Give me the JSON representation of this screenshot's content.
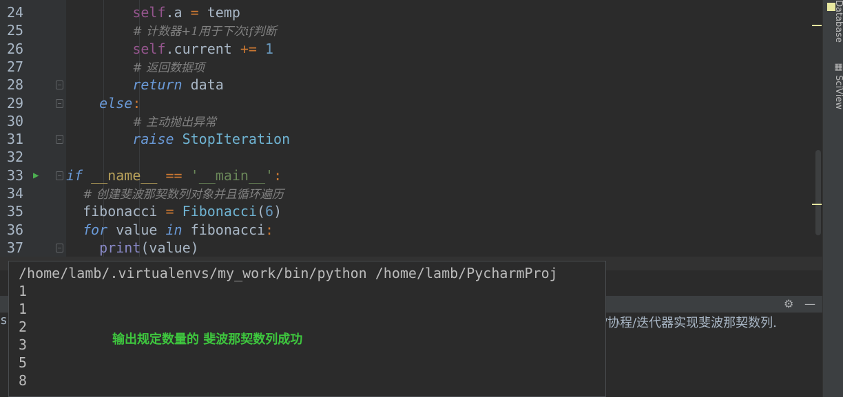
{
  "editor": {
    "lines": [
      {
        "num": "24",
        "indent": "        ",
        "tokens": [
          {
            "t": "self",
            "c": "kw-self"
          },
          {
            "t": ".a ",
            "c": "plain"
          },
          {
            "t": "=",
            "c": "op"
          },
          {
            "t": " temp",
            "c": "plain"
          }
        ]
      },
      {
        "num": "25",
        "indent": "        ",
        "tokens": [
          {
            "t": "# 计数器+1用于下次if判断",
            "c": "cmt"
          }
        ]
      },
      {
        "num": "26",
        "indent": "        ",
        "tokens": [
          {
            "t": "self",
            "c": "kw-self"
          },
          {
            "t": ".current ",
            "c": "plain"
          },
          {
            "t": "+=",
            "c": "op"
          },
          {
            "t": " ",
            "c": "plain"
          },
          {
            "t": "1",
            "c": "num"
          }
        ]
      },
      {
        "num": "27",
        "indent": "        ",
        "tokens": [
          {
            "t": "# 返回数据项",
            "c": "cmt"
          }
        ]
      },
      {
        "num": "28",
        "indent": "        ",
        "tokens": [
          {
            "t": "return",
            "c": "kw-i"
          },
          {
            "t": " data",
            "c": "plain"
          }
        ]
      },
      {
        "num": "29",
        "indent": "    ",
        "tokens": [
          {
            "t": "else",
            "c": "kw-i"
          },
          {
            "t": ":",
            "c": "op"
          }
        ]
      },
      {
        "num": "30",
        "indent": "        ",
        "tokens": [
          {
            "t": "# 主动抛出异常",
            "c": "cmt"
          }
        ]
      },
      {
        "num": "31",
        "indent": "        ",
        "tokens": [
          {
            "t": "raise",
            "c": "kw-i"
          },
          {
            "t": " StopIteration",
            "c": "cls"
          }
        ]
      },
      {
        "num": "32",
        "indent": "",
        "tokens": []
      },
      {
        "num": "33",
        "indent": "",
        "tokens": [
          {
            "t": "if",
            "c": "kw-i"
          },
          {
            "t": " __name__ ",
            "c": "dunder"
          },
          {
            "t": "==",
            "c": "op"
          },
          {
            "t": " ",
            "c": "plain"
          },
          {
            "t": "'__main__'",
            "c": "str"
          },
          {
            "t": ":",
            "c": "op"
          }
        ]
      },
      {
        "num": "34",
        "indent": "  ",
        "tokens": [
          {
            "t": "# 创建斐波那契数列对象并且循环遍历",
            "c": "cmt"
          }
        ]
      },
      {
        "num": "35",
        "indent": "  ",
        "tokens": [
          {
            "t": "fibonacci ",
            "c": "plain"
          },
          {
            "t": "=",
            "c": "op"
          },
          {
            "t": " ",
            "c": "plain"
          },
          {
            "t": "Fibonacci",
            "c": "cls"
          },
          {
            "t": "(",
            "c": "plain"
          },
          {
            "t": "6",
            "c": "num"
          },
          {
            "t": ")",
            "c": "plain"
          }
        ]
      },
      {
        "num": "36",
        "indent": "  ",
        "tokens": [
          {
            "t": "for",
            "c": "kw-i"
          },
          {
            "t": " value ",
            "c": "plain"
          },
          {
            "t": "in",
            "c": "kw-i"
          },
          {
            "t": " fibonacci",
            "c": "plain"
          },
          {
            "t": ":",
            "c": "op"
          }
        ]
      },
      {
        "num": "37",
        "indent": "    ",
        "tokens": [
          {
            "t": "print",
            "c": "builtin"
          },
          {
            "t": "(value)",
            "c": "plain"
          }
        ]
      }
    ]
  },
  "sidebar": {
    "database_label": "Database",
    "sciview_label": "SciView",
    "sciview_icon": "grid-icon"
  },
  "run_panel": {
    "path_fragment": "/协程/迭代器实现斐波那契数列.",
    "left_fragment": "s",
    "settings_icon": "gear-icon",
    "minimize_icon": "minimize-icon"
  },
  "output": {
    "command": "/home/lamb/.virtualenvs/my_work/bin/python /home/lamb/PycharmProj",
    "values": [
      "1",
      "1",
      "2",
      "3",
      "5",
      "8"
    ],
    "annotation": "输出规定数量的 斐波那契数列成功"
  },
  "colors": {
    "background": "#2b2b2b",
    "gutter": "#313335",
    "success_text": "#3ec73e"
  }
}
